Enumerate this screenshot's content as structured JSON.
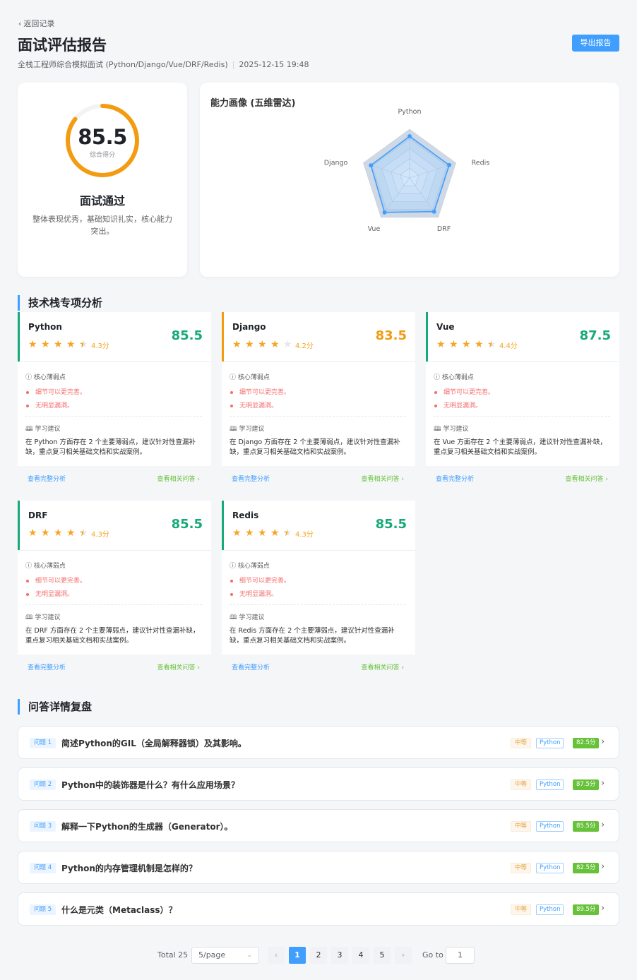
{
  "header": {
    "back_label": "返回记录",
    "title": "面试评估报告",
    "subtitle_position": "全栈工程师综合模拟面试 (Python/Django/Vue/DRF/Redis)",
    "subtitle_date": "2025-12-15 19:48",
    "export_label": "导出报告"
  },
  "score": {
    "value": "85.5",
    "gauge_fraction": 0.855,
    "label": "综合得分",
    "result": "面试通过",
    "summary": "整体表现优秀，基础知识扎实，核心能力突出。"
  },
  "radar": {
    "title": "能力画像 (五维雷达)",
    "chart_data": {
      "type": "radar",
      "axes": [
        "Python",
        "Redis",
        "DRF",
        "Vue",
        "Django"
      ],
      "values": [
        85.5,
        85.5,
        85.5,
        87.5,
        83.5
      ],
      "range": [
        0,
        100
      ]
    }
  },
  "tech_section_title": "技术栈专项分析",
  "tech": [
    {
      "name": "Python",
      "rating": 4.3,
      "rating_label": "4.3分",
      "score": "85.5",
      "color": "green",
      "weak_title": "核心薄弱点",
      "weak": [
        "细节可以更完善。",
        "无明显漏洞。"
      ],
      "learn_title": "学习建议",
      "learn": "在 Python 方面存在 2 个主要薄弱点，建议针对性查漏补缺，重点复习相关基础文档和实战案例。",
      "link_left": "查看完整分析",
      "link_right": "查看相关问答 ›"
    },
    {
      "name": "Django",
      "rating": 4.2,
      "rating_label": "4.2分",
      "score": "83.5",
      "color": "orange",
      "weak_title": "核心薄弱点",
      "weak": [
        "细节可以更完善。",
        "无明显漏洞。"
      ],
      "learn_title": "学习建议",
      "learn": "在 Django 方面存在 2 个主要薄弱点，建议针对性查漏补缺，重点复习相关基础文档和实战案例。",
      "link_left": "查看完整分析",
      "link_right": "查看相关问答 ›"
    },
    {
      "name": "Vue",
      "rating": 4.4,
      "rating_label": "4.4分",
      "score": "87.5",
      "color": "green",
      "weak_title": "核心薄弱点",
      "weak": [
        "细节可以更完善。",
        "无明显漏洞。"
      ],
      "learn_title": "学习建议",
      "learn": "在 Vue 方面存在 2 个主要薄弱点，建议针对性查漏补缺，重点复习相关基础文档和实战案例。",
      "link_left": "查看完整分析",
      "link_right": "查看相关问答 ›"
    },
    {
      "name": "DRF",
      "rating": 4.3,
      "rating_label": "4.3分",
      "score": "85.5",
      "color": "green",
      "weak_title": "核心薄弱点",
      "weak": [
        "细节可以更完善。",
        "无明显漏洞。"
      ],
      "learn_title": "学习建议",
      "learn": "在 DRF 方面存在 2 个主要薄弱点，建议针对性查漏补缺，重点复习相关基础文档和实战案例。",
      "link_left": "查看完整分析",
      "link_right": "查看相关问答 ›"
    },
    {
      "name": "Redis",
      "rating": 4.3,
      "rating_label": "4.3分",
      "score": "85.5",
      "color": "green",
      "weak_title": "核心薄弱点",
      "weak": [
        "细节可以更完善。",
        "无明显漏洞。"
      ],
      "learn_title": "学习建议",
      "learn": "在 Redis 方面存在 2 个主要薄弱点，建议针对性查漏补缺，重点复习相关基础文档和实战案例。",
      "link_left": "查看完整分析",
      "link_right": "查看相关问答 ›"
    }
  ],
  "qa_section_title": "问答详情复盘",
  "questions": [
    {
      "tag": "问题 1",
      "text": "简述Python的GIL（全局解释器锁）及其影响。",
      "difficulty": "中等",
      "category": "Python",
      "score": "82.5分"
    },
    {
      "tag": "问题 2",
      "text": "Python中的装饰器是什么？有什么应用场景？",
      "difficulty": "中等",
      "category": "Python",
      "score": "87.5分"
    },
    {
      "tag": "问题 3",
      "text": "解释一下Python的生成器（Generator）。",
      "difficulty": "中等",
      "category": "Python",
      "score": "85.5分"
    },
    {
      "tag": "问题 4",
      "text": "Python的内存管理机制是怎样的？",
      "difficulty": "中等",
      "category": "Python",
      "score": "82.5分"
    },
    {
      "tag": "问题 5",
      "text": "什么是元类（Metaclass）？",
      "difficulty": "中等",
      "category": "Python",
      "score": "89.5分"
    }
  ],
  "pagination": {
    "total": "Total 25",
    "page_size": "5/page",
    "pages": [
      "1",
      "2",
      "3",
      "4",
      "5"
    ],
    "current": "1",
    "goto_label": "Go to",
    "goto_value": "1"
  }
}
